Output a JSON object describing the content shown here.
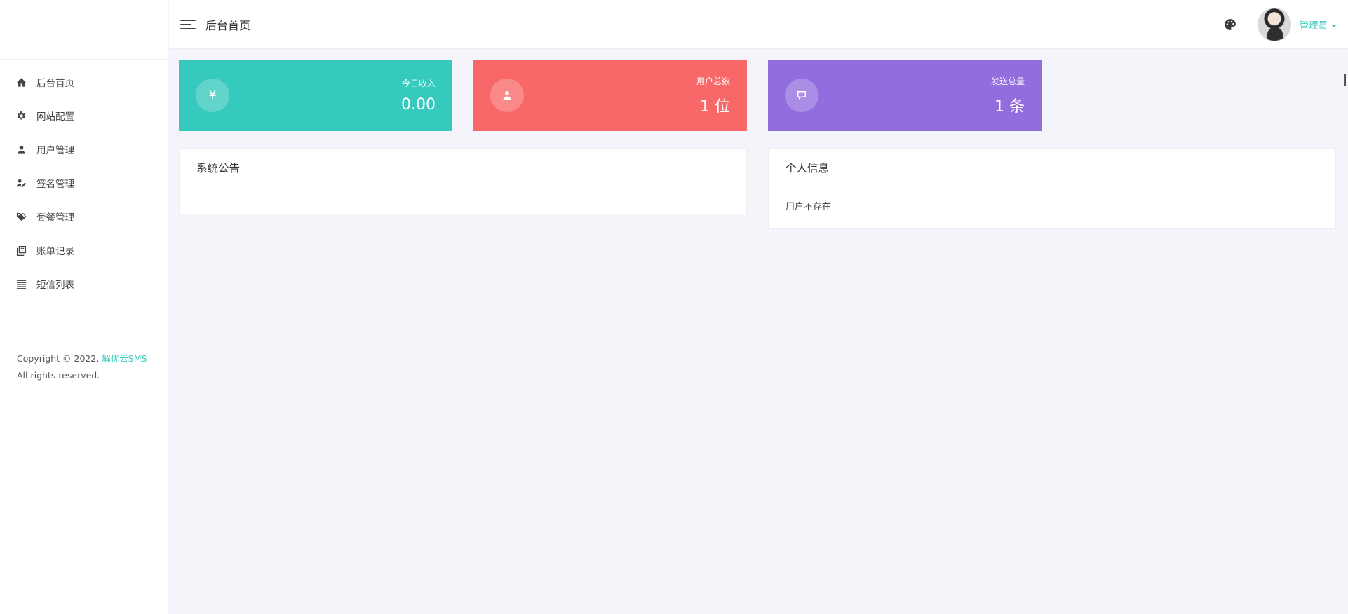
{
  "sidebar": {
    "items": [
      {
        "label": "后台首页",
        "icon": "home-icon"
      },
      {
        "label": "网站配置",
        "icon": "gear-icon"
      },
      {
        "label": "用户管理",
        "icon": "user-icon"
      },
      {
        "label": "签名管理",
        "icon": "signature-icon"
      },
      {
        "label": "套餐管理",
        "icon": "tags-icon"
      },
      {
        "label": "账单记录",
        "icon": "ledger-icon"
      },
      {
        "label": "短信列表",
        "icon": "list-icon"
      }
    ],
    "copyright": {
      "prefix": "Copyright © 2022.",
      "brand": "解优云SMS",
      "rights": "All rights reserved."
    }
  },
  "header": {
    "title": "后台首页",
    "user": "管理员"
  },
  "stats": [
    {
      "label": "今日收入",
      "value": "0.00",
      "icon": "¥",
      "color": "#35cabd"
    },
    {
      "label": "用户总数",
      "value": "1 位",
      "icon": "user-icon",
      "color": "#f96868"
    },
    {
      "label": "发送总量",
      "value": "1 条",
      "icon": "message-icon",
      "color": "#926dde"
    }
  ],
  "panels": {
    "notice": {
      "title": "系统公告",
      "body": ""
    },
    "profile": {
      "title": "个人信息",
      "body": "用户不存在"
    }
  },
  "colors": {
    "accent": "#34cabc",
    "background": "#f4f5fa"
  }
}
